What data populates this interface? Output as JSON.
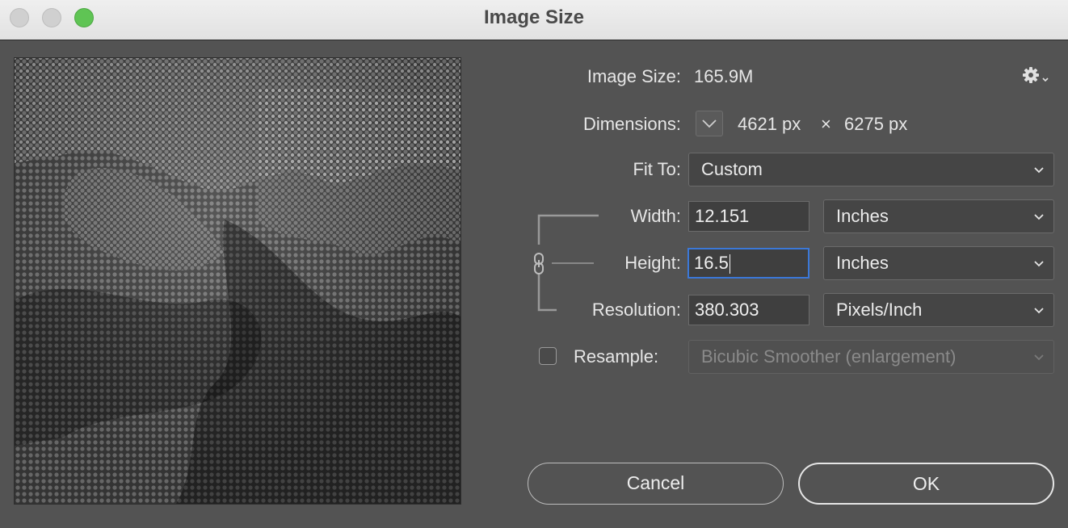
{
  "window": {
    "title": "Image Size"
  },
  "info": {
    "image_size_label": "Image Size:",
    "image_size_value": "165.9M",
    "dimensions_label": "Dimensions:",
    "dim_width": "4621 px",
    "dim_separator": "×",
    "dim_height": "6275 px"
  },
  "fit_to": {
    "label": "Fit To:",
    "selected": "Custom"
  },
  "width": {
    "label": "Width:",
    "value": "12.151",
    "unit": "Inches"
  },
  "height": {
    "label": "Height:",
    "value": "16.5",
    "unit": "Inches"
  },
  "resolution": {
    "label": "Resolution:",
    "value": "380.303",
    "unit": "Pixels/Inch"
  },
  "resample": {
    "label": "Resample:",
    "checked": false,
    "method": "Bicubic Smoother (enlargement)"
  },
  "buttons": {
    "cancel": "Cancel",
    "ok": "OK"
  },
  "icons": {
    "settings": "gear-icon",
    "link": "chain-link-icon",
    "dropdown": "chevron-down-icon"
  }
}
